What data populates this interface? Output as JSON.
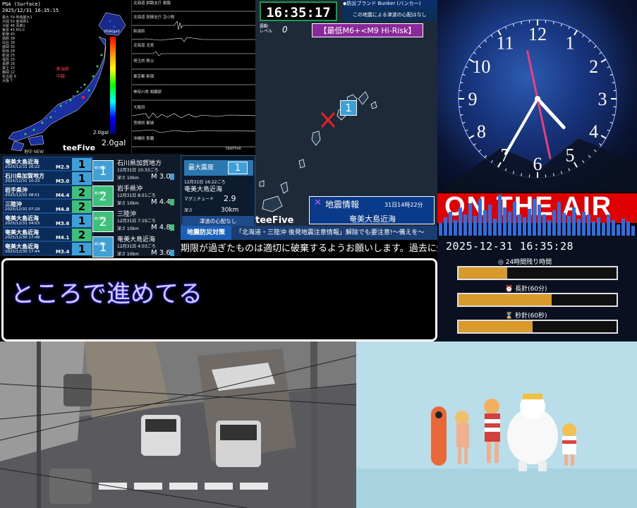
{
  "pga": {
    "title": "PGA (Surface)",
    "time": "2025/12/31 16:35:15",
    "stations": [
      "最大 59 地域最大1",
      "大間 50 宮城県1",
      "大船 48 青森1",
      "東京 45 M3.0",
      "新宿 40",
      "函館 38",
      "仙台 34",
      "盛岡 30",
      "秋田 28",
      "新潟 25",
      "福島 20",
      "長野 18",
      "富士 15",
      "静岡 12",
      "名古屋 9",
      "大阪 7"
    ],
    "scale_unit": "PGA(gal)",
    "gal_small": "2.0gal",
    "gal_label": "2.0gal"
  },
  "waveforms": {
    "rows": [
      {
        "label": "北海道 釧路支庁 釧路"
      },
      {
        "label": "北海道 胆振支庁 苫小牧"
      },
      {
        "label": "新潟県"
      },
      {
        "label": "北海道 北見"
      },
      {
        "label": "埼玉県 秩父"
      },
      {
        "label": "東京都 新宿"
      },
      {
        "label": "神奈川県 相模原"
      },
      {
        "label": "大阪府"
      },
      {
        "label": "宮崎県 都城"
      },
      {
        "label": "沖縄県 那覇"
      }
    ],
    "brand": "teeFive"
  },
  "intensity_list": {
    "header": "地中 NEW",
    "rows": [
      {
        "region": "奄美大島近海",
        "datetime": "2025/12/31 16:22",
        "mag": "M2.9",
        "int": "1",
        "color": "#3fa0d8"
      },
      {
        "region": "石川県加賀地方",
        "datetime": "2025/12/31 10:33",
        "mag": "M3.0",
        "int": "1",
        "color": "#3fa0d8"
      },
      {
        "region": "岩手県沖",
        "datetime": "2025/12/31 08:51",
        "mag": "M4.4",
        "int": "2",
        "color": "#3fc07a"
      },
      {
        "region": "三陸沖",
        "datetime": "2025/12/31 07:19",
        "mag": "M4.8",
        "int": "2",
        "color": "#3fc07a"
      },
      {
        "region": "奄美大島近海",
        "datetime": "2025/12/31 04:03",
        "mag": "M3.6",
        "int": "1",
        "color": "#3fa0d8"
      },
      {
        "region": "奄美大島近海",
        "datetime": "2025/12/30 17:48",
        "mag": "M4.1",
        "int": "2",
        "color": "#3fc07a"
      },
      {
        "region": "奄美大島近海",
        "datetime": "2025/12/30 17:44",
        "mag": "M3.4",
        "int": "1",
        "color": "#3fa0d8"
      }
    ],
    "brand": "teeFive"
  },
  "mid_list": {
    "badge_caption": "最大震度",
    "rows": [
      {
        "int": "1",
        "region": "石川県加賀地方",
        "datetime": "12月31日 10:33ごろ",
        "depth": "深さ 10km",
        "mag": "M 3.0",
        "color": "#3fa0d8"
      },
      {
        "int": "2",
        "region": "岩手県沖",
        "datetime": "12月31日 8:51ごろ",
        "depth": "深さ 10km",
        "mag": "M 4.4",
        "color": "#3fc07a"
      },
      {
        "int": "2",
        "region": "三陸沖",
        "datetime": "12月31日 7:19ごろ",
        "depth": "深さ 10km",
        "mag": "M 4.8",
        "color": "#3fc07a"
      },
      {
        "int": "1",
        "region": "奄美大島近海",
        "datetime": "12月31日 4:03ごろ",
        "depth": "深さ 10km",
        "mag": "M 3.6",
        "color": "#3fa0d8"
      }
    ]
  },
  "detail": {
    "heading": "最大震度",
    "intensity": "1",
    "datetime": "12月31日 16:22ごろ",
    "region": "奄美大島近海",
    "mag_label": "マグニチュード",
    "magnitude": "2.9",
    "depth_label": "深さ",
    "depth": "30km",
    "tsunami": "津波の心配なし"
  },
  "center": {
    "clock": "16:35:17",
    "bunker_title": "◆防災ブランド Bunker (バンカー)",
    "bunker_msg": "この地震による津波の心配はなし",
    "level_label": "震動\nレベル",
    "level_value": "0",
    "risk": "【最低M6+<M9 Hi-Risk】",
    "map_int": "1",
    "brand": "teeFive",
    "info_icon": "✕",
    "info_title": "地震情報",
    "info_time": "31日14時22分",
    "info_region": "奄美大島近海"
  },
  "ticker": {
    "tag": "地震防災対策",
    "text": "「北海道・三陸沖 後発地震注意情報」解除でも要注意!～備えを～",
    "scroll": "期限が過ぎたものは適切に破棄するようお願いします。過去に爆発した例"
  },
  "subtitle": {
    "text": "ところで進めてる"
  },
  "clock": {
    "numbers": [
      "12",
      "1",
      "2",
      "3",
      "4",
      "5",
      "6",
      "7",
      "8",
      "9",
      "10",
      "11"
    ],
    "hour": 4,
    "minute": 35,
    "second": 28
  },
  "onair": {
    "text": "ON THE AIR"
  },
  "datetime_panel": {
    "datetime": "2025-12-31 16:35:28",
    "bars": [
      {
        "label": "◎ 24時間残り時間",
        "value": 0.31
      },
      {
        "label": "⏰ 長針(60分)",
        "value": 0.59
      },
      {
        "label": "⌛ 秒針(60秒)",
        "value": 0.47
      }
    ]
  },
  "colors": {
    "accent": "#3fa0d8",
    "int2": "#3fc07a",
    "onair": "#e00000",
    "bar_fill": "#d89a2a",
    "subtitle_text": "#d8c8ff"
  }
}
